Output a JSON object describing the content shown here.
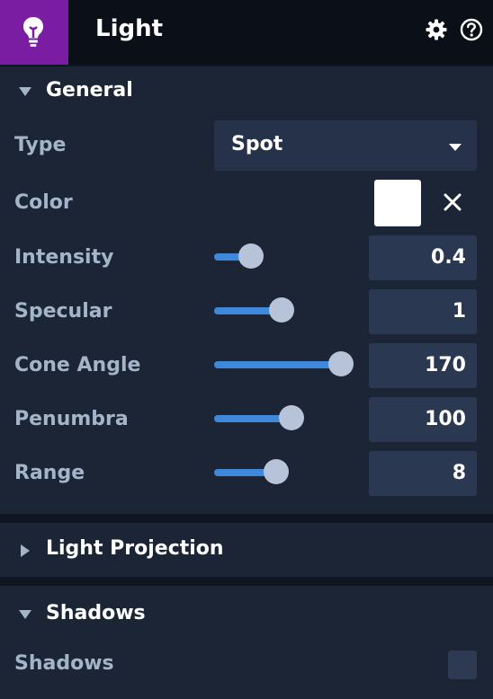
{
  "header": {
    "title": "Light",
    "icon": "lightbulb-icon"
  },
  "sections": {
    "general": {
      "label": "General",
      "expanded": true
    },
    "light_projection": {
      "label": "Light Projection",
      "expanded": false
    },
    "shadows": {
      "label": "Shadows",
      "expanded": true
    }
  },
  "general": {
    "type": {
      "label": "Type",
      "value": "Spot"
    },
    "color": {
      "label": "Color",
      "value": "#ffffff"
    },
    "intensity": {
      "label": "Intensity",
      "value": "0.4",
      "slider_fraction": 0.27
    },
    "specular": {
      "label": "Specular",
      "value": "1",
      "slider_fraction": 0.5
    },
    "cone_angle": {
      "label": "Cone Angle",
      "value": "170",
      "slider_fraction": 0.94
    },
    "penumbra": {
      "label": "Penumbra",
      "value": "100",
      "slider_fraction": 0.57
    },
    "range": {
      "label": "Range",
      "value": "8",
      "slider_fraction": 0.46
    }
  },
  "shadows": {
    "shadows": {
      "label": "Shadows",
      "checked": false
    }
  },
  "colors": {
    "accent": "#7a1da3",
    "slider": "#3f89dc"
  }
}
